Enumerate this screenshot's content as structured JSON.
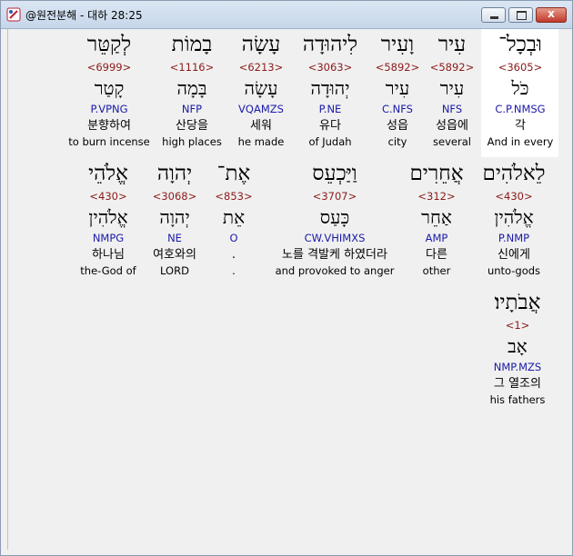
{
  "window": {
    "title": "@원전분해 - 대하 28:25",
    "close_glyph": "x"
  },
  "rows": [
    {
      "words": [
        {
          "heb": "וּבְכָל־",
          "strong": "<3605>",
          "root": "כֹּל",
          "morph": "C.P.NMSG",
          "ko": "각",
          "en": "And in every"
        },
        {
          "heb": "עִיר",
          "strong": "<5892>",
          "root": "עִיר",
          "morph": "NFS",
          "ko": "성읍에",
          "en": "several"
        },
        {
          "heb": "וָעִיר",
          "strong": "<5892>",
          "root": "עִיר",
          "morph": "C.NFS",
          "ko": "성읍",
          "en": "city"
        },
        {
          "heb": "לִיהוּדָה",
          "strong": "<3063>",
          "root": "יְהוּדָה",
          "morph": "P.NE",
          "ko": "유다",
          "en": "of Judah"
        },
        {
          "heb": "עָשָׂה",
          "strong": "<6213>",
          "root": "עָשָׂה",
          "morph": "VQAMZS",
          "ko": "세워",
          "en": "he made"
        },
        {
          "heb": "בָמוֹת",
          "strong": "<1116>",
          "root": "בָּמָה",
          "morph": "NFP",
          "ko": "산당을",
          "en": "high places"
        },
        {
          "heb": "לְקַטֵּר",
          "strong": "<6999>",
          "root": "קָטַר",
          "morph": "P.VPNG",
          "ko": "분향하여",
          "en": "to burn incense"
        }
      ]
    },
    {
      "words": [
        {
          "heb": "לֵאלֹהִים",
          "strong": "<430>",
          "root": "אֱלֹהִין",
          "morph": "P.NMP",
          "ko": "신에게",
          "en": "unto-gods"
        },
        {
          "heb": "אֲחֵרִים",
          "strong": "<312>",
          "root": "אַחֵר",
          "morph": "AMP",
          "ko": "다른",
          "en": "other"
        },
        {
          "heb": "וַיַּכְעֵס",
          "strong": "<3707>",
          "root": "כָּעַס",
          "morph": "CW.VHIMXS",
          "ko": "노를 격발케 하였더라",
          "en": "and provoked to anger"
        },
        {
          "heb": "אֶת־",
          "strong": "<853>",
          "root": "אֵת",
          "morph": "O",
          "ko": ".",
          "en": "."
        },
        {
          "heb": "יְהוָה",
          "strong": "<3068>",
          "root": "יְהוָה",
          "morph": "NE",
          "ko": "여호와의",
          "en": "LORD"
        },
        {
          "heb": "אֱלֹהֵי",
          "strong": "<430>",
          "root": "אֱלֹהִין",
          "morph": "NMPG",
          "ko": "하나님",
          "en": "the-God of"
        }
      ]
    },
    {
      "words": [
        {
          "heb": "אֲבֹתָיו׃",
          "strong": "<1>",
          "root": "אָב",
          "morph": "NMP.MZS",
          "ko": "그 열조의",
          "en": "his fathers"
        }
      ]
    }
  ]
}
